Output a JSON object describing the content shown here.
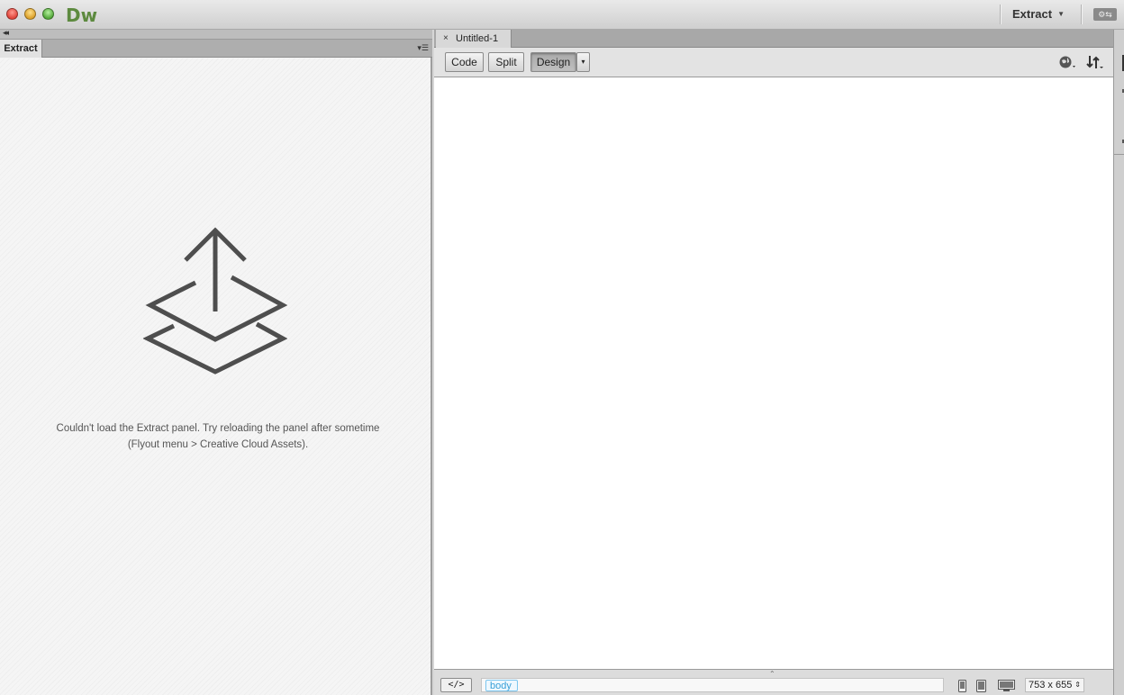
{
  "app": {
    "logo": "Dw"
  },
  "workspace": {
    "label": "Extract"
  },
  "left_panel": {
    "tab_label": "Extract",
    "message": "Couldn't load the Extract panel. Try reloading the panel after sometime (Flyout menu > Creative Cloud Assets)."
  },
  "document": {
    "tab_name": "Untitled-1",
    "close_glyph": "×",
    "view_buttons": {
      "code": "Code",
      "split": "Split",
      "design": "Design"
    },
    "design_dropdown_glyph": "▾"
  },
  "statusbar": {
    "code_button": "</>",
    "tag": "body",
    "window_size": "753 x 655"
  }
}
